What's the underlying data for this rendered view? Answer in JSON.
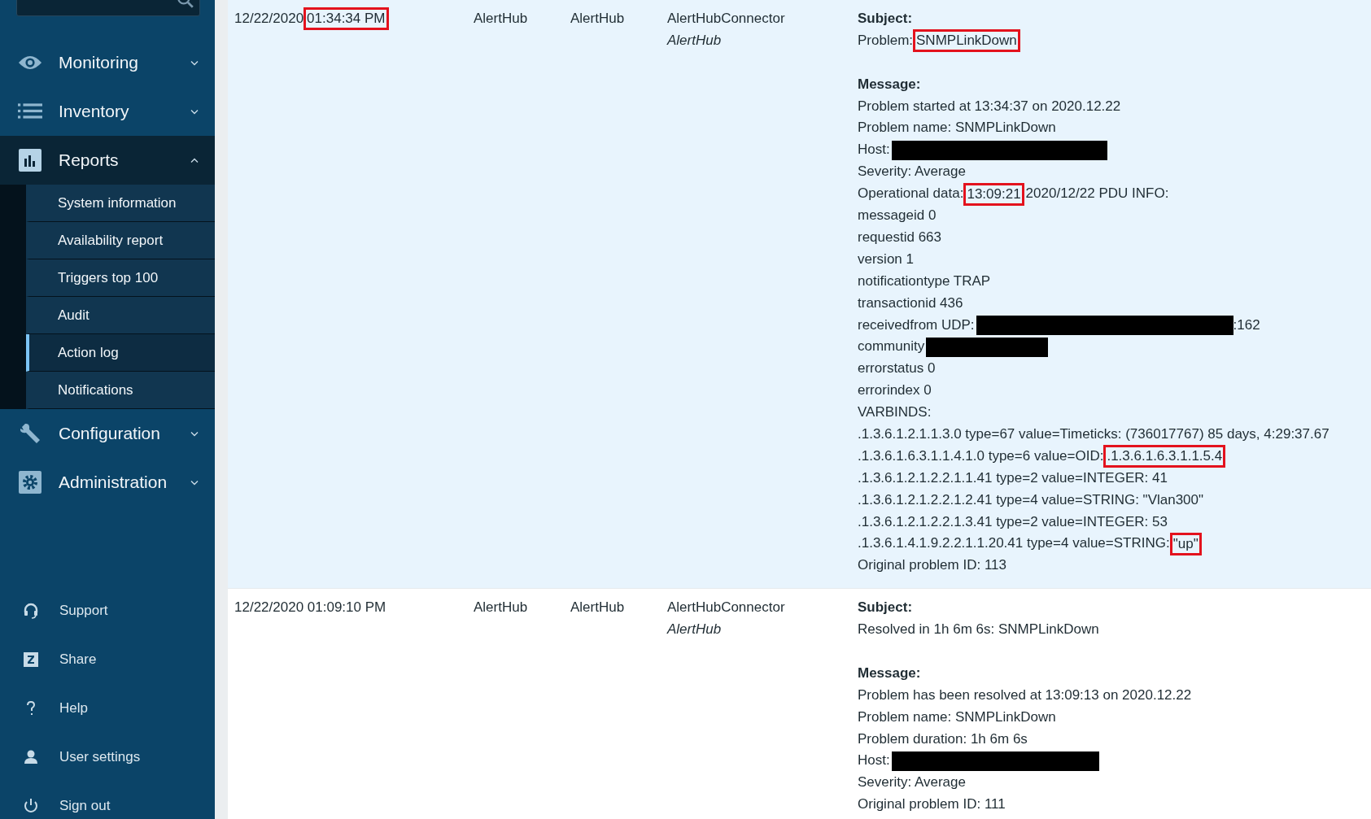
{
  "sidebar": {
    "menu": [
      {
        "label": "Monitoring",
        "expanded": false
      },
      {
        "label": "Inventory",
        "expanded": false
      },
      {
        "label": "Reports",
        "expanded": true,
        "children": [
          {
            "label": "System information",
            "selected": false
          },
          {
            "label": "Availability report",
            "selected": false
          },
          {
            "label": "Triggers top 100",
            "selected": false
          },
          {
            "label": "Audit",
            "selected": false
          },
          {
            "label": "Action log",
            "selected": true
          },
          {
            "label": "Notifications",
            "selected": false
          }
        ]
      },
      {
        "label": "Configuration",
        "expanded": false
      },
      {
        "label": "Administration",
        "expanded": false
      }
    ],
    "links": [
      "Support",
      "Share",
      "Help",
      "User settings",
      "Sign out"
    ]
  },
  "rows": [
    {
      "highlighted": true,
      "time": [
        {
          "kind": "text",
          "text": "12/22/2020"
        },
        {
          "kind": "highlight",
          "text": "01:34:34 PM"
        }
      ],
      "column_2": "AlertHub",
      "column_3": "AlertHub",
      "media_type": "AlertHubConnector",
      "user": "AlertHub",
      "subject_label": "Subject:",
      "subject": [
        {
          "kind": "text",
          "text": "Problem:"
        },
        {
          "kind": "highlight",
          "text": "SNMPLinkDown"
        }
      ],
      "message_label": "Message:",
      "message": [
        [
          {
            "kind": "text",
            "text": "Problem started at 13:34:37 on 2020.12.22"
          }
        ],
        [
          {
            "kind": "text",
            "text": "Problem name: SNMPLinkDown"
          }
        ],
        [
          {
            "kind": "text",
            "text": "Host:"
          },
          {
            "kind": "redacted"
          }
        ],
        [
          {
            "kind": "text",
            "text": "Severity: Average"
          }
        ],
        [
          {
            "kind": "text",
            "text": "Operational data:"
          },
          {
            "kind": "highlight",
            "text": "13:09:21"
          },
          {
            "kind": "text",
            "text": "2020/12/22 PDU INFO:"
          }
        ],
        [
          {
            "kind": "text",
            "text": "messageid 0"
          }
        ],
        [
          {
            "kind": "text",
            "text": "requestid 663"
          }
        ],
        [
          {
            "kind": "text",
            "text": "version 1"
          }
        ],
        [
          {
            "kind": "text",
            "text": "notificationtype TRAP"
          }
        ],
        [
          {
            "kind": "text",
            "text": "transactionid 436"
          }
        ],
        [
          {
            "kind": "text",
            "text": "receivedfrom UDP:"
          },
          {
            "kind": "redacted"
          },
          {
            "kind": "text",
            "text": ":162"
          }
        ],
        [
          {
            "kind": "text",
            "text": "community"
          },
          {
            "kind": "redacted"
          }
        ],
        [
          {
            "kind": "text",
            "text": "errorstatus 0"
          }
        ],
        [
          {
            "kind": "text",
            "text": "errorindex 0"
          }
        ],
        [
          {
            "kind": "text",
            "text": "VARBINDS:"
          }
        ],
        [
          {
            "kind": "text",
            "text": ".1.3.6.1.2.1.1.3.0 type=67 value=Timeticks: (736017767) 85 days, 4:29:37.67"
          }
        ],
        [
          {
            "kind": "text",
            "text": ".1.3.6.1.6.3.1.1.4.1.0 type=6 value=OID:"
          },
          {
            "kind": "highlight",
            "text": ".1.3.6.1.6.3.1.1.5.4"
          }
        ],
        [
          {
            "kind": "text",
            "text": ".1.3.6.1.2.1.2.2.1.1.41 type=2 value=INTEGER: 41"
          }
        ],
        [
          {
            "kind": "text",
            "text": ".1.3.6.1.2.1.2.2.1.2.41 type=4 value=STRING: \"Vlan300\""
          }
        ],
        [
          {
            "kind": "text",
            "text": ".1.3.6.1.2.1.2.2.1.3.41 type=2 value=INTEGER: 53"
          }
        ],
        [
          {
            "kind": "text",
            "text": ".1.3.6.1.4.1.9.2.2.1.1.20.41 type=4 value=STRING:"
          },
          {
            "kind": "highlight",
            "text": "\"up\""
          }
        ],
        [
          {
            "kind": "text",
            "text": "Original problem ID: 113"
          }
        ]
      ]
    },
    {
      "highlighted": false,
      "time": [
        {
          "kind": "text",
          "text": "12/22/2020 01:09:10 PM"
        }
      ],
      "column_2": "AlertHub",
      "column_3": "AlertHub",
      "media_type": "AlertHubConnector",
      "user": "AlertHub",
      "subject_label": "Subject:",
      "subject": [
        {
          "kind": "text",
          "text": "Resolved in 1h 6m 6s: SNMPLinkDown"
        }
      ],
      "message_label": "Message:",
      "message": [
        [
          {
            "kind": "text",
            "text": "Problem has been resolved at 13:09:13 on 2020.12.22"
          }
        ],
        [
          {
            "kind": "text",
            "text": "Problem name: SNMPLinkDown"
          }
        ],
        [
          {
            "kind": "text",
            "text": "Problem duration: 1h 6m 6s"
          }
        ],
        [
          {
            "kind": "text",
            "text": "Host:"
          },
          {
            "kind": "redacted"
          }
        ],
        [
          {
            "kind": "text",
            "text": "Severity: Average"
          }
        ],
        [
          {
            "kind": "text",
            "text": "Original problem ID: 111"
          }
        ]
      ]
    }
  ]
}
